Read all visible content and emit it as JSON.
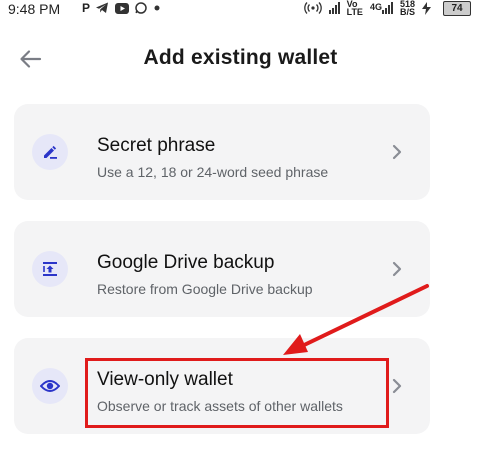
{
  "status_bar": {
    "time": "9:48 PM",
    "app_icons": [
      "P",
      "telegram-icon",
      "youtube-icon",
      "whatsapp-icon",
      "dot"
    ],
    "network_label_1": "Vo",
    "network_label_2": "LTE",
    "network_4g": "4G",
    "speed": "518",
    "speed_unit": "B/S",
    "battery": "74"
  },
  "header": {
    "title": "Add existing wallet"
  },
  "options": [
    {
      "title": "Secret phrase",
      "subtitle": "Use a 12, 18 or 24-word seed phrase",
      "icon": "pen-icon"
    },
    {
      "title": "Google Drive backup",
      "subtitle": "Restore from Google Drive backup",
      "icon": "restore-icon"
    },
    {
      "title": "View-only wallet",
      "subtitle": "Observe or track assets of other wallets",
      "icon": "eye-icon"
    }
  ],
  "colors": {
    "accent": "#2b35c9",
    "card_bg": "#f4f4f5",
    "icon_bg": "#e6e7f8",
    "annotation": "#e01b1b"
  }
}
